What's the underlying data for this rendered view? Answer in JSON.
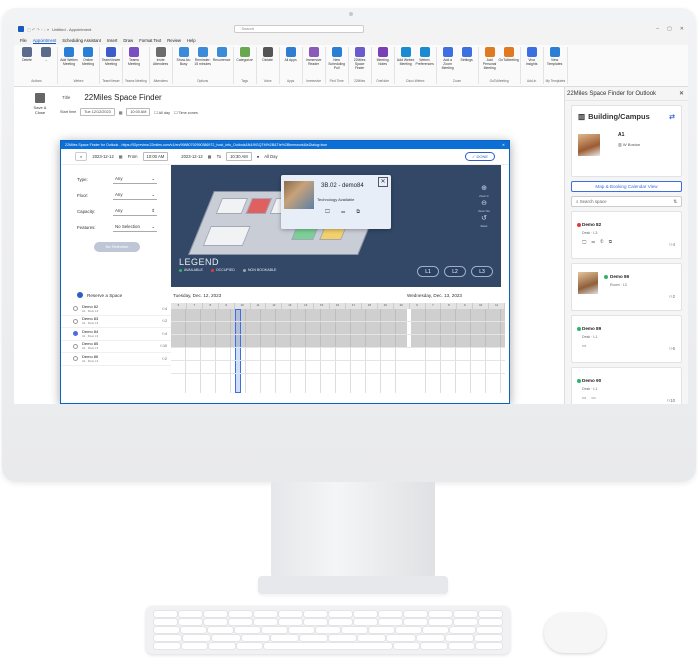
{
  "colors": {
    "accent": "#185abd",
    "available": "#2fb36b",
    "occupied": "#e03b3b",
    "not_bookable": "#9aa4b5"
  },
  "window": {
    "title": "Untitled - Appointment",
    "search_placeholder": "Search"
  },
  "menu": [
    "File",
    "Appointment",
    "Scheduling Assistant",
    "Insert",
    "Draw",
    "Format Text",
    "Review",
    "Help"
  ],
  "ribbon": {
    "groups": [
      {
        "label": "Actions",
        "buttons": [
          "Delete",
          "→"
        ]
      },
      {
        "label": "Webex",
        "buttons": [
          "Add Webex Meeting",
          "Online Meeting"
        ]
      },
      {
        "label": "TeamViewer",
        "buttons": [
          "TeamViewer Meeting"
        ]
      },
      {
        "label": "Teams Meeting",
        "buttons": [
          "Teams Meeting"
        ]
      },
      {
        "label": "Attendees",
        "buttons": [
          "Invite Attendees"
        ]
      },
      {
        "label": "Options",
        "buttons": [
          "Show As: Busy",
          "Reminder: 15 minutes",
          "Recurrence"
        ]
      },
      {
        "label": "Tags",
        "buttons": [
          "Categorize"
        ]
      },
      {
        "label": "Voice",
        "buttons": [
          "Dictate"
        ]
      },
      {
        "label": "Apps",
        "buttons": [
          "All Apps"
        ]
      },
      {
        "label": "Immersive",
        "buttons": [
          "Immersive Reader"
        ]
      },
      {
        "label": "Find Time",
        "buttons": [
          "New Scheduling Poll"
        ]
      },
      {
        "label": "22Miles",
        "buttons": [
          "22Miles Space Finder"
        ]
      },
      {
        "label": "OneNote",
        "buttons": [
          "Meeting Notes"
        ]
      },
      {
        "label": "Cisco Webex",
        "buttons": [
          "Add Webex Meeting",
          "Webex Preferences"
        ]
      },
      {
        "label": "Zoom",
        "buttons": [
          "Add a Zoom Meeting",
          "Settings"
        ]
      },
      {
        "label": "GoToMeeting",
        "buttons": [
          "Add Personal Meeting",
          "GoToMeeting"
        ]
      },
      {
        "label": "Add-in",
        "buttons": [
          "Viva Insights"
        ]
      },
      {
        "label": "My Templates",
        "buttons": [
          "View Templates"
        ]
      }
    ]
  },
  "form": {
    "save_label": "Save & Close",
    "title_label": "Title",
    "title_value": "22Miles Space Finder",
    "start_label": "Start time",
    "start_date": "Tue 12/12/2023",
    "start_time": "10:00 AM",
    "all_day": "All day",
    "time_zones": "Time zones"
  },
  "dialog": {
    "title": "22Miles Space Finder for Outlook - https://92preview.22miles.com/v1/en/99880792990386972_host_info_Outlook&N&I9GQTM%2B&Tte%2Bimmwork&isDialog=true",
    "close": "✕",
    "from_date": "2023-12-12",
    "from_label": "From",
    "from_time": "10:00 AM",
    "to_date": "2023-12-12",
    "to_label": "To",
    "to_time": "10:30 AM",
    "all_day": "All Day",
    "done": "DONE",
    "filters": [
      {
        "label": "Type:",
        "value": "Any"
      },
      {
        "label": "Floor:",
        "value": "Any"
      },
      {
        "label": "Capacity:",
        "value": "Any"
      },
      {
        "label": "Features:",
        "value": "No Selection"
      }
    ],
    "no_selection": "No Selection",
    "popup": {
      "title": "3B.02 - demo84",
      "subtitle": "Technology Available",
      "icons": "🖵 ▭ ⧉",
      "close": "✕"
    },
    "zoom": {
      "in": "⊕",
      "in_label": "Zoom In",
      "out": "⊖",
      "out_label": "Zoom Out",
      "reset": "↺",
      "reset_label": "Reset"
    },
    "legend": {
      "title": "LEGEND",
      "available": "AVAILABLE",
      "occupied": "OCCUPIED",
      "not_bookable": "NON BOOKABLE"
    },
    "levels": [
      "L1",
      "L2",
      "L3"
    ],
    "reserve_label": "Reserve a Space",
    "date1": "Tuesday, Dec. 12, 2023",
    "date2": "Wednesday, Dec. 13, 2023",
    "hours": [
      "6",
      "7",
      "8",
      "9",
      "10",
      "11",
      "12",
      "13",
      "14",
      "15",
      "16",
      "17",
      "18",
      "19",
      "20",
      "6",
      "7",
      "8",
      "9",
      "10",
      "11"
    ],
    "rooms": [
      {
        "name": "Demo 82",
        "sub": "A1 · Floor L3",
        "cap": "4",
        "selected": false
      },
      {
        "name": "Demo 83",
        "sub": "A1 · Floor L3",
        "cap": "2",
        "selected": false
      },
      {
        "name": "Demo 84",
        "sub": "A1 · Floor L3",
        "cap": "4",
        "selected": true
      },
      {
        "name": "Demo 85",
        "sub": "A1 · Floor L3",
        "cap": "10",
        "selected": false
      },
      {
        "name": "Demo 86",
        "sub": "A1 · Floor L3",
        "cap": "2",
        "selected": false
      }
    ]
  },
  "panel": {
    "title": "22Miles Space Finder for Outlook",
    "close": "✕",
    "building_label": "Building/Campus",
    "building_name": "A1",
    "building_addr": "W Boston",
    "map_button": "Map & Booking Calendar View",
    "search_placeholder": "Search space",
    "spaces": [
      {
        "name": "Demo 82",
        "desc": "Desk · L3",
        "icons": "🖵 ▭ ✆ ⧉",
        "cap": "4",
        "status": "occupied"
      },
      {
        "name": "Demo 86",
        "desc": "Room · L3",
        "icons": "",
        "cap": "2",
        "status": "available",
        "image": true
      },
      {
        "name": "Demo 89",
        "desc": "Desk · L1",
        "icons": "▭",
        "cap": "6",
        "status": "available"
      },
      {
        "name": "Demo 90",
        "desc": "Desk · L1",
        "icons": "▭ ▭",
        "cap": "10",
        "status": "available"
      }
    ]
  }
}
